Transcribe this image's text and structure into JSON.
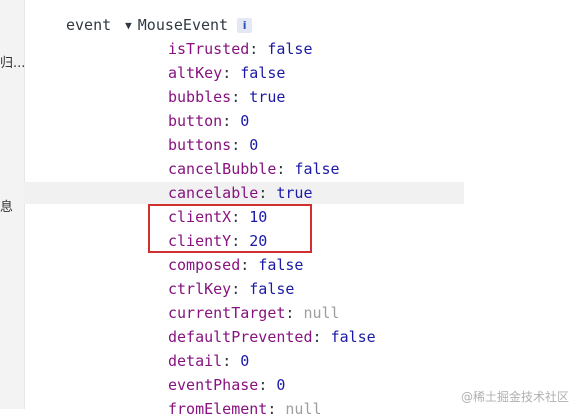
{
  "left_strip": {
    "glyph_top": "归...",
    "glyph_bottom": "息"
  },
  "header": {
    "key": "event",
    "arrow": "▼",
    "type": "MouseEvent",
    "info": "i"
  },
  "properties": [
    {
      "key": "isTrusted",
      "value": "false",
      "kind": "bool"
    },
    {
      "key": "altKey",
      "value": "false",
      "kind": "bool"
    },
    {
      "key": "bubbles",
      "value": "true",
      "kind": "bool"
    },
    {
      "key": "button",
      "value": "0",
      "kind": "num"
    },
    {
      "key": "buttons",
      "value": "0",
      "kind": "num"
    },
    {
      "key": "cancelBubble",
      "value": "false",
      "kind": "bool"
    },
    {
      "key": "cancelable",
      "value": "true",
      "kind": "bool"
    },
    {
      "key": "clientX",
      "value": "10",
      "kind": "num"
    },
    {
      "key": "clientY",
      "value": "20",
      "kind": "num"
    },
    {
      "key": "composed",
      "value": "false",
      "kind": "bool"
    },
    {
      "key": "ctrlKey",
      "value": "false",
      "kind": "bool"
    },
    {
      "key": "currentTarget",
      "value": "null",
      "kind": "null"
    },
    {
      "key": "defaultPrevented",
      "value": "false",
      "kind": "bool"
    },
    {
      "key": "detail",
      "value": "0",
      "kind": "num"
    },
    {
      "key": "eventPhase",
      "value": "0",
      "kind": "num"
    },
    {
      "key": "fromElement",
      "value": "null",
      "kind": "null"
    }
  ],
  "hovered_row": 6,
  "highlighted_rows": [
    7,
    8
  ],
  "highlight_color": "#d03030",
  "watermark": "@稀土掘金技术社区"
}
